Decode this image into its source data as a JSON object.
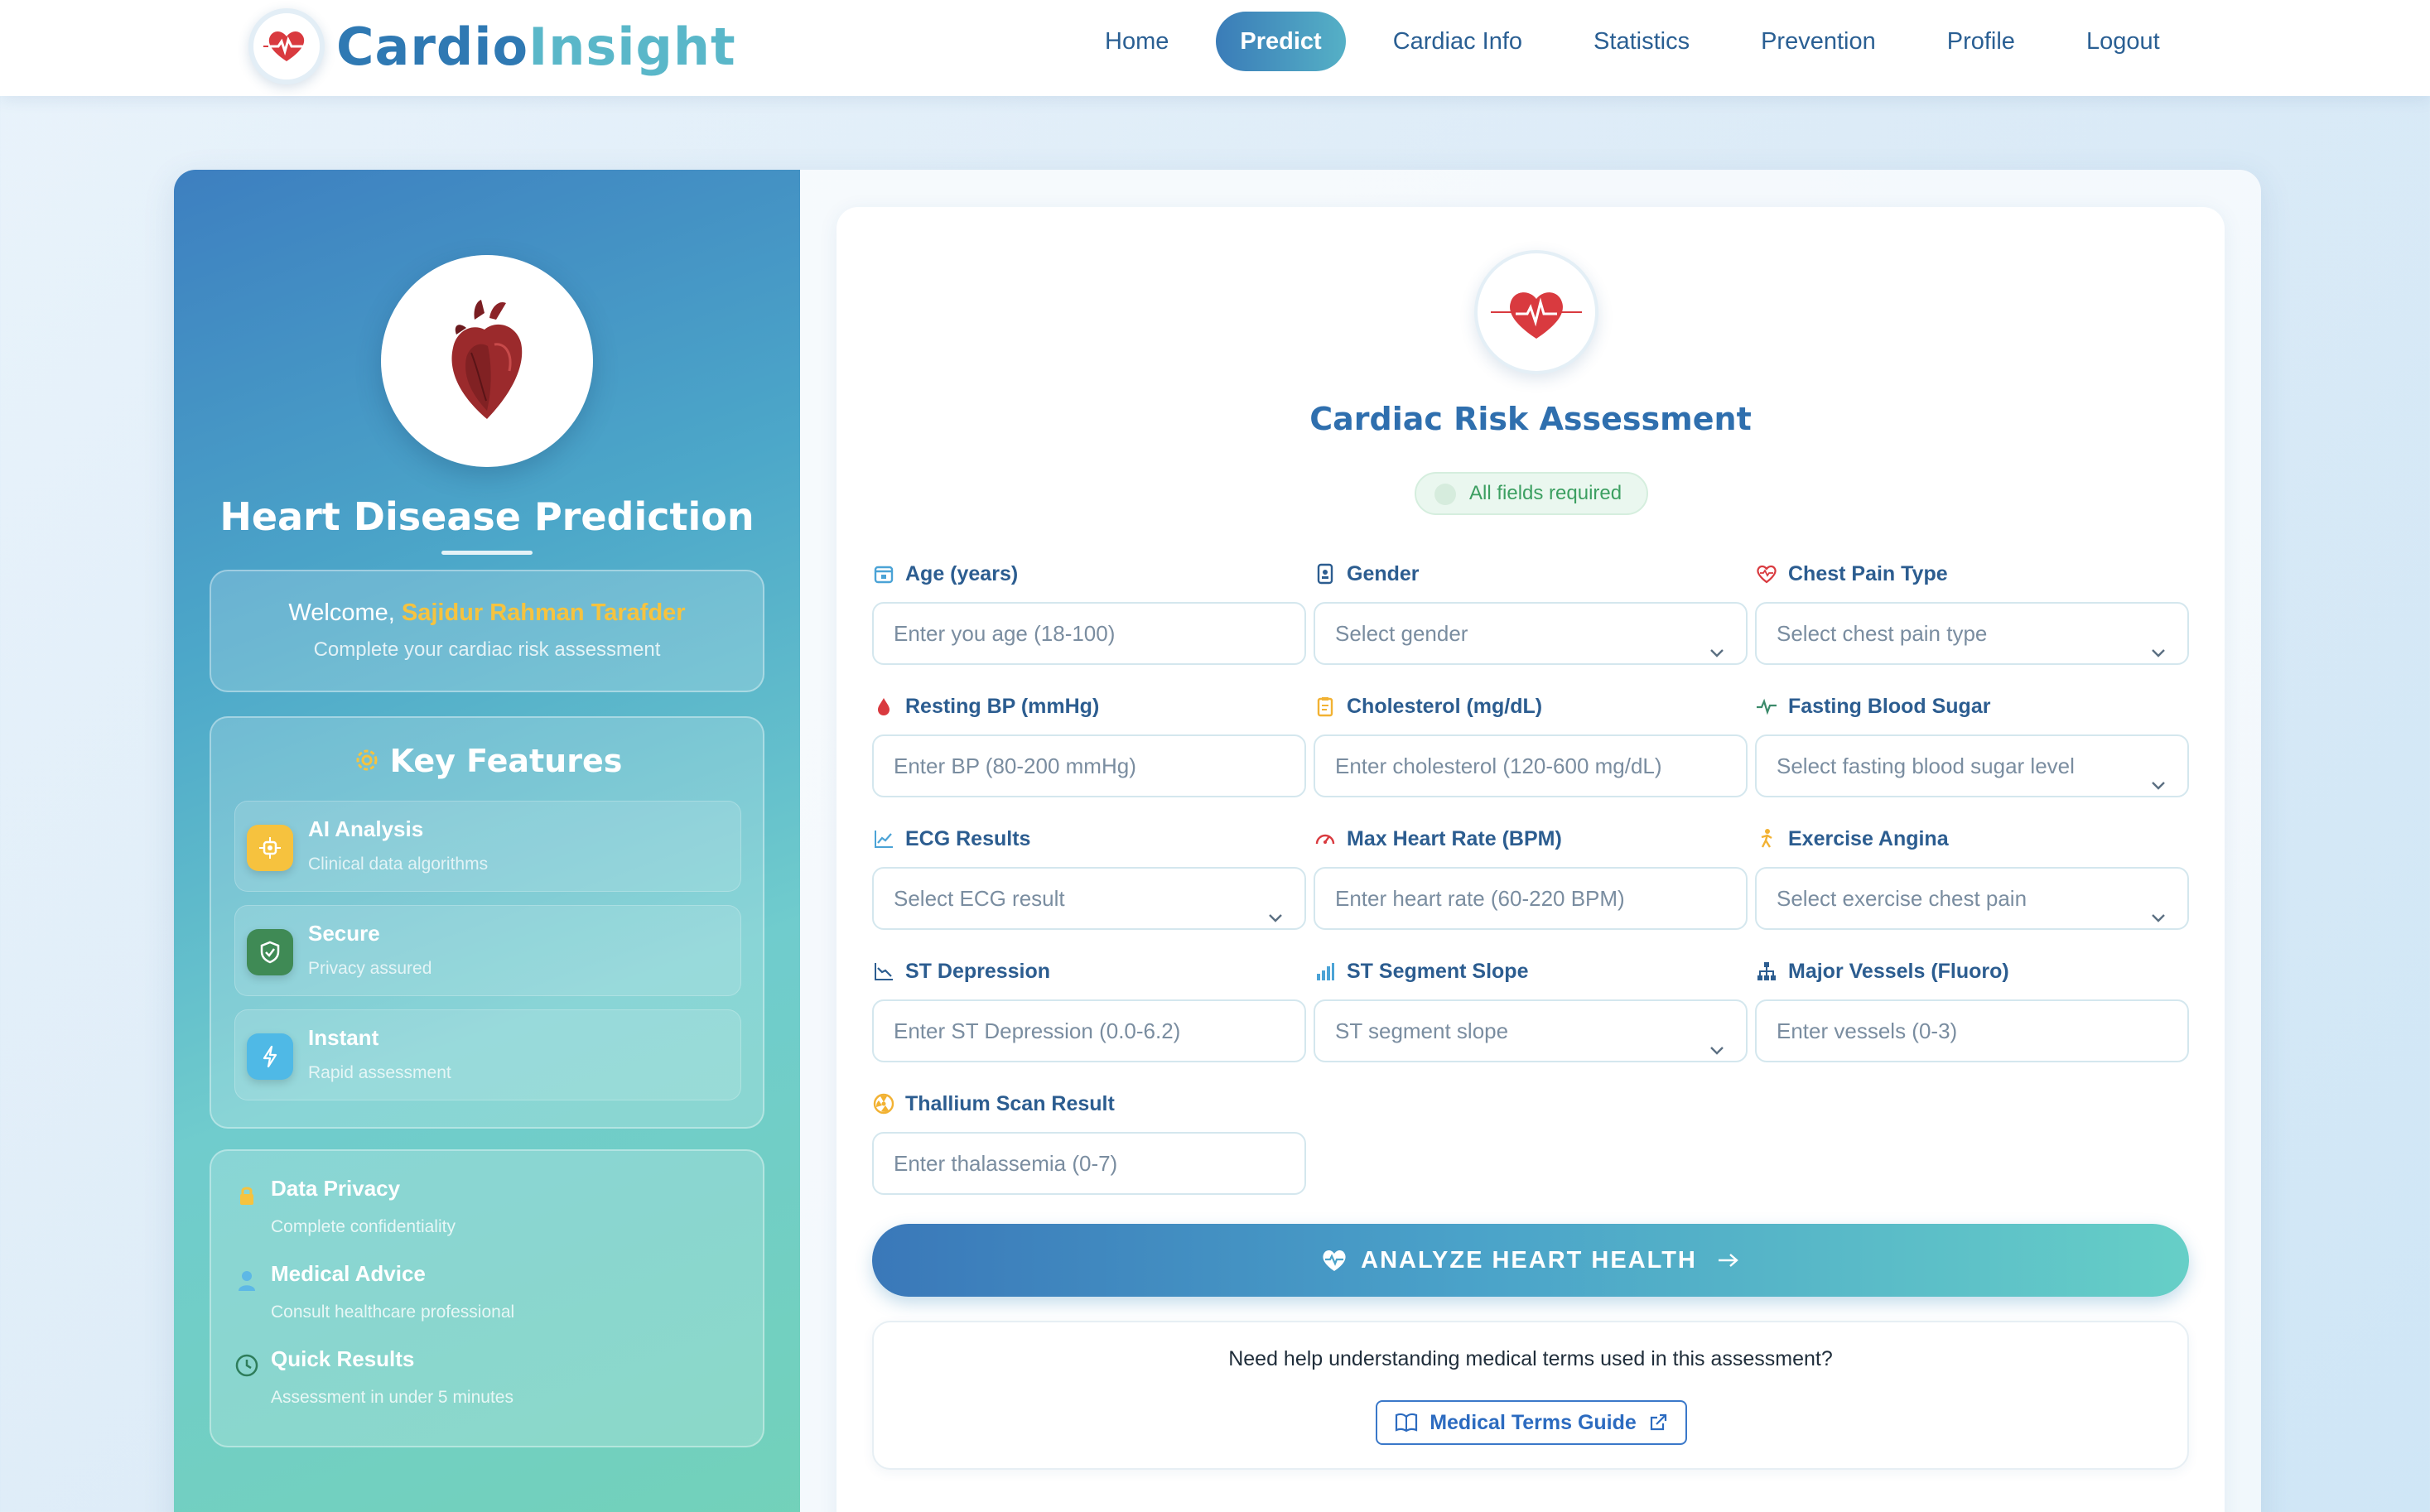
{
  "brand": {
    "part1": "Cardio",
    "part2": "Insight",
    "logo_icon": "heart-pulse-icon"
  },
  "nav": {
    "items": [
      {
        "label": "Home",
        "active": false
      },
      {
        "label": "Predict",
        "active": true
      },
      {
        "label": "Cardiac Info",
        "active": false
      },
      {
        "label": "Statistics",
        "active": false
      },
      {
        "label": "Prevention",
        "active": false
      },
      {
        "label": "Profile",
        "active": false
      },
      {
        "label": "Logout",
        "active": false
      }
    ]
  },
  "sidebar": {
    "title": "Heart Disease Prediction",
    "welcome": {
      "prefix": "Welcome,",
      "user": "Sajidur Rahman Tarafder",
      "subtitle": "Complete your cardiac risk assessment"
    },
    "features_heading": "Key Features",
    "features": [
      {
        "title": "AI Analysis",
        "subtitle": "Clinical data algorithms",
        "icon": "chip-icon",
        "color": "#f6c23e"
      },
      {
        "title": "Secure",
        "subtitle": "Privacy assured",
        "icon": "shield-icon",
        "color": "#3f8a55"
      },
      {
        "title": "Instant",
        "subtitle": "Rapid assessment",
        "icon": "bolt-icon",
        "color": "#4fb9e6"
      }
    ],
    "info": [
      {
        "title": "Data Privacy",
        "subtitle": "Complete confidentiality",
        "icon": "lock-icon"
      },
      {
        "title": "Medical Advice",
        "subtitle": "Consult healthcare professional",
        "icon": "doctor-icon"
      },
      {
        "title": "Quick Results",
        "subtitle": "Assessment in under 5 minutes",
        "icon": "clock-icon"
      }
    ]
  },
  "form": {
    "title": "Cardiac Risk Assessment",
    "required_badge": "All fields required",
    "fields": [
      {
        "label": "Age (years)",
        "placeholder": "Enter you age (18-100)",
        "type": "input",
        "icon": "calendar-icon"
      },
      {
        "label": "Gender",
        "placeholder": "Select gender",
        "type": "select",
        "icon": "id-card-icon"
      },
      {
        "label": "Chest Pain Type",
        "placeholder": "Select chest pain type",
        "type": "select",
        "icon": "heart-pulse-icon"
      },
      {
        "label": "Resting BP (mmHg)",
        "placeholder": "Enter BP (80-200 mmHg)",
        "type": "input",
        "icon": "blood-drop-icon"
      },
      {
        "label": "Cholesterol (mg/dL)",
        "placeholder": "Enter cholesterol (120-600 mg/dL)",
        "type": "input",
        "icon": "clipboard-icon"
      },
      {
        "label": "Fasting Blood Sugar",
        "placeholder": "Select fasting blood sugar level",
        "type": "select",
        "icon": "pulse-line-icon"
      },
      {
        "label": "ECG Results",
        "placeholder": "Select ECG result",
        "type": "select",
        "icon": "chart-line-icon"
      },
      {
        "label": "Max Heart Rate (BPM)",
        "placeholder": "Enter heart rate (60-220 BPM)",
        "type": "input",
        "icon": "gauge-icon"
      },
      {
        "label": "Exercise Angina",
        "placeholder": "Select exercise chest pain",
        "type": "select",
        "icon": "running-icon"
      },
      {
        "label": "ST Depression",
        "placeholder": "Enter ST Depression (0.0-6.2)",
        "type": "input",
        "icon": "chart-down-icon"
      },
      {
        "label": "ST Segment Slope",
        "placeholder": "ST segment slope",
        "type": "select",
        "icon": "bar-chart-icon"
      },
      {
        "label": "Major Vessels (Fluoro)",
        "placeholder": "Enter vessels (0-3)",
        "type": "input",
        "icon": "sitemap-icon"
      },
      {
        "label": "Thallium Scan Result",
        "placeholder": "Enter thalassemia (0-7)",
        "type": "input",
        "icon": "radiation-icon"
      }
    ],
    "analyze_label": "ANALYZE HEART HEALTH",
    "help_text": "Need help understanding medical terms used in this assessment?",
    "help_link": "Medical Terms Guide"
  },
  "colors": {
    "accent_blue": "#2f79b3",
    "accent_teal": "#5ab7c9",
    "highlight_user": "#f6c33f",
    "badge_green": "#3c9f61"
  }
}
